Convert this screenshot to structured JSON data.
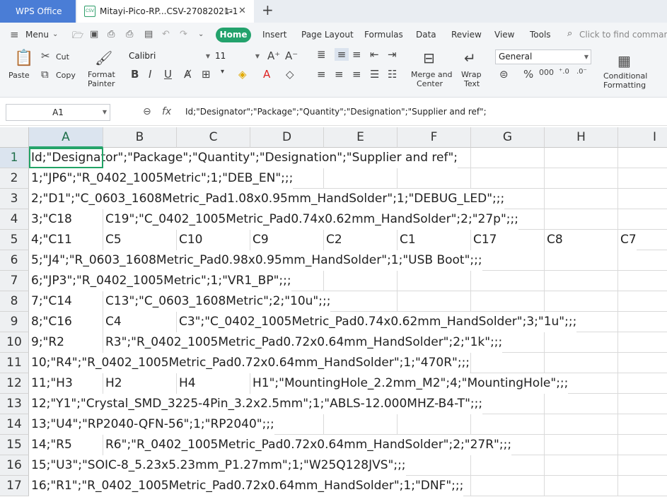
{
  "titlebar": {
    "app_tab": "WPS Office",
    "doc_tab": "Mitayi-Pico-RP...CSV-27082021-1",
    "csv_badge": "CSV"
  },
  "menubar": {
    "menu": "Menu",
    "tabs": [
      "Home",
      "Insert",
      "Page Layout",
      "Formulas",
      "Data",
      "Review",
      "View",
      "Tools"
    ],
    "search_placeholder": "Click to find comman"
  },
  "ribbon": {
    "paste": "Paste",
    "cut": "Cut",
    "copy": "Copy",
    "format_painter_1": "Format",
    "format_painter_2": "Painter",
    "font_name": "Calibri",
    "font_size": "11",
    "merge_1": "Merge and",
    "merge_2": "Center",
    "wrap_1": "Wrap",
    "wrap_2": "Text",
    "number_format": "General",
    "cond_1": "Conditional",
    "cond_2": "Formatting"
  },
  "formula_bar": {
    "name_box": "A1",
    "fx": "fx",
    "content": "Id;\"Designator\";\"Package\";\"Quantity\";\"Designation\";\"Supplier and ref\";"
  },
  "columns": [
    "A",
    "B",
    "C",
    "D",
    "E",
    "F",
    "G",
    "H",
    "I"
  ],
  "rows": [
    {
      "num": "1",
      "cells": [
        "Id;\"Designator\";\"Package\";\"Quantity\";\"Designation\";\"Supplier and ref\";"
      ]
    },
    {
      "num": "2",
      "cells": [
        "1;\"JP6\";\"R_0402_1005Metric\";1;\"DEB_EN\";;;"
      ]
    },
    {
      "num": "3",
      "cells": [
        "2;\"D1\";\"C_0603_1608Metric_Pad1.08x0.95mm_HandSolder\";1;\"DEBUG_LED\";;;"
      ]
    },
    {
      "num": "4",
      "cells": [
        "3;\"C18",
        "C19\";\"C_0402_1005Metric_Pad0.74x0.62mm_HandSolder\";2;\"27p\";;;"
      ]
    },
    {
      "num": "5",
      "cells": [
        "4;\"C11",
        "C5",
        "C10",
        "C9",
        "C2",
        "C1",
        "C17",
        "C8",
        "C7"
      ]
    },
    {
      "num": "6",
      "cells": [
        "5;\"J4\";\"R_0603_1608Metric_Pad0.98x0.95mm_HandSolder\";1;\"USB Boot\";;;"
      ]
    },
    {
      "num": "7",
      "cells": [
        "6;\"JP3\";\"R_0402_1005Metric\";1;\"VR1_BP\";;;"
      ]
    },
    {
      "num": "8",
      "cells": [
        "7;\"C14",
        "C13\";\"C_0603_1608Metric\";2;\"10u\";;;"
      ]
    },
    {
      "num": "9",
      "cells": [
        "8;\"C16",
        "C4",
        "C3\";\"C_0402_1005Metric_Pad0.74x0.62mm_HandSolder\";3;\"1u\";;;"
      ]
    },
    {
      "num": "10",
      "cells": [
        "9;\"R2",
        "R3\";\"R_0402_1005Metric_Pad0.72x0.64mm_HandSolder\";2;\"1k\";;;"
      ]
    },
    {
      "num": "11",
      "cells": [
        "10;\"R4\";\"R_0402_1005Metric_Pad0.72x0.64mm_HandSolder\";1;\"470R\";;;"
      ]
    },
    {
      "num": "12",
      "cells": [
        "11;\"H3",
        "H2",
        "H4",
        "H1\";\"MountingHole_2.2mm_M2\";4;\"MountingHole\";;;"
      ]
    },
    {
      "num": "13",
      "cells": [
        "12;\"Y1\";\"Crystal_SMD_3225-4Pin_3.2x2.5mm\";1;\"ABLS-12.000MHZ-B4-T\";;;"
      ]
    },
    {
      "num": "14",
      "cells": [
        "13;\"U4\";\"RP2040-QFN-56\";1;\"RP2040\";;;"
      ]
    },
    {
      "num": "15",
      "cells": [
        "14;\"R5",
        "R6\";\"R_0402_1005Metric_Pad0.72x0.64mm_HandSolder\";2;\"27R\";;;"
      ]
    },
    {
      "num": "16",
      "cells": [
        "15;\"U3\";\"SOIC-8_5.23x5.23mm_P1.27mm\";1;\"W25Q128JVS\";;;"
      ]
    },
    {
      "num": "17",
      "cells": [
        "16;\"R1\";\"R_0402_1005Metric_Pad0.72x0.64mm_HandSolder\";1;\"DNF\";;;"
      ]
    }
  ],
  "colors": {
    "accent": "#21a366",
    "app_tab": "#4a7dd6"
  }
}
